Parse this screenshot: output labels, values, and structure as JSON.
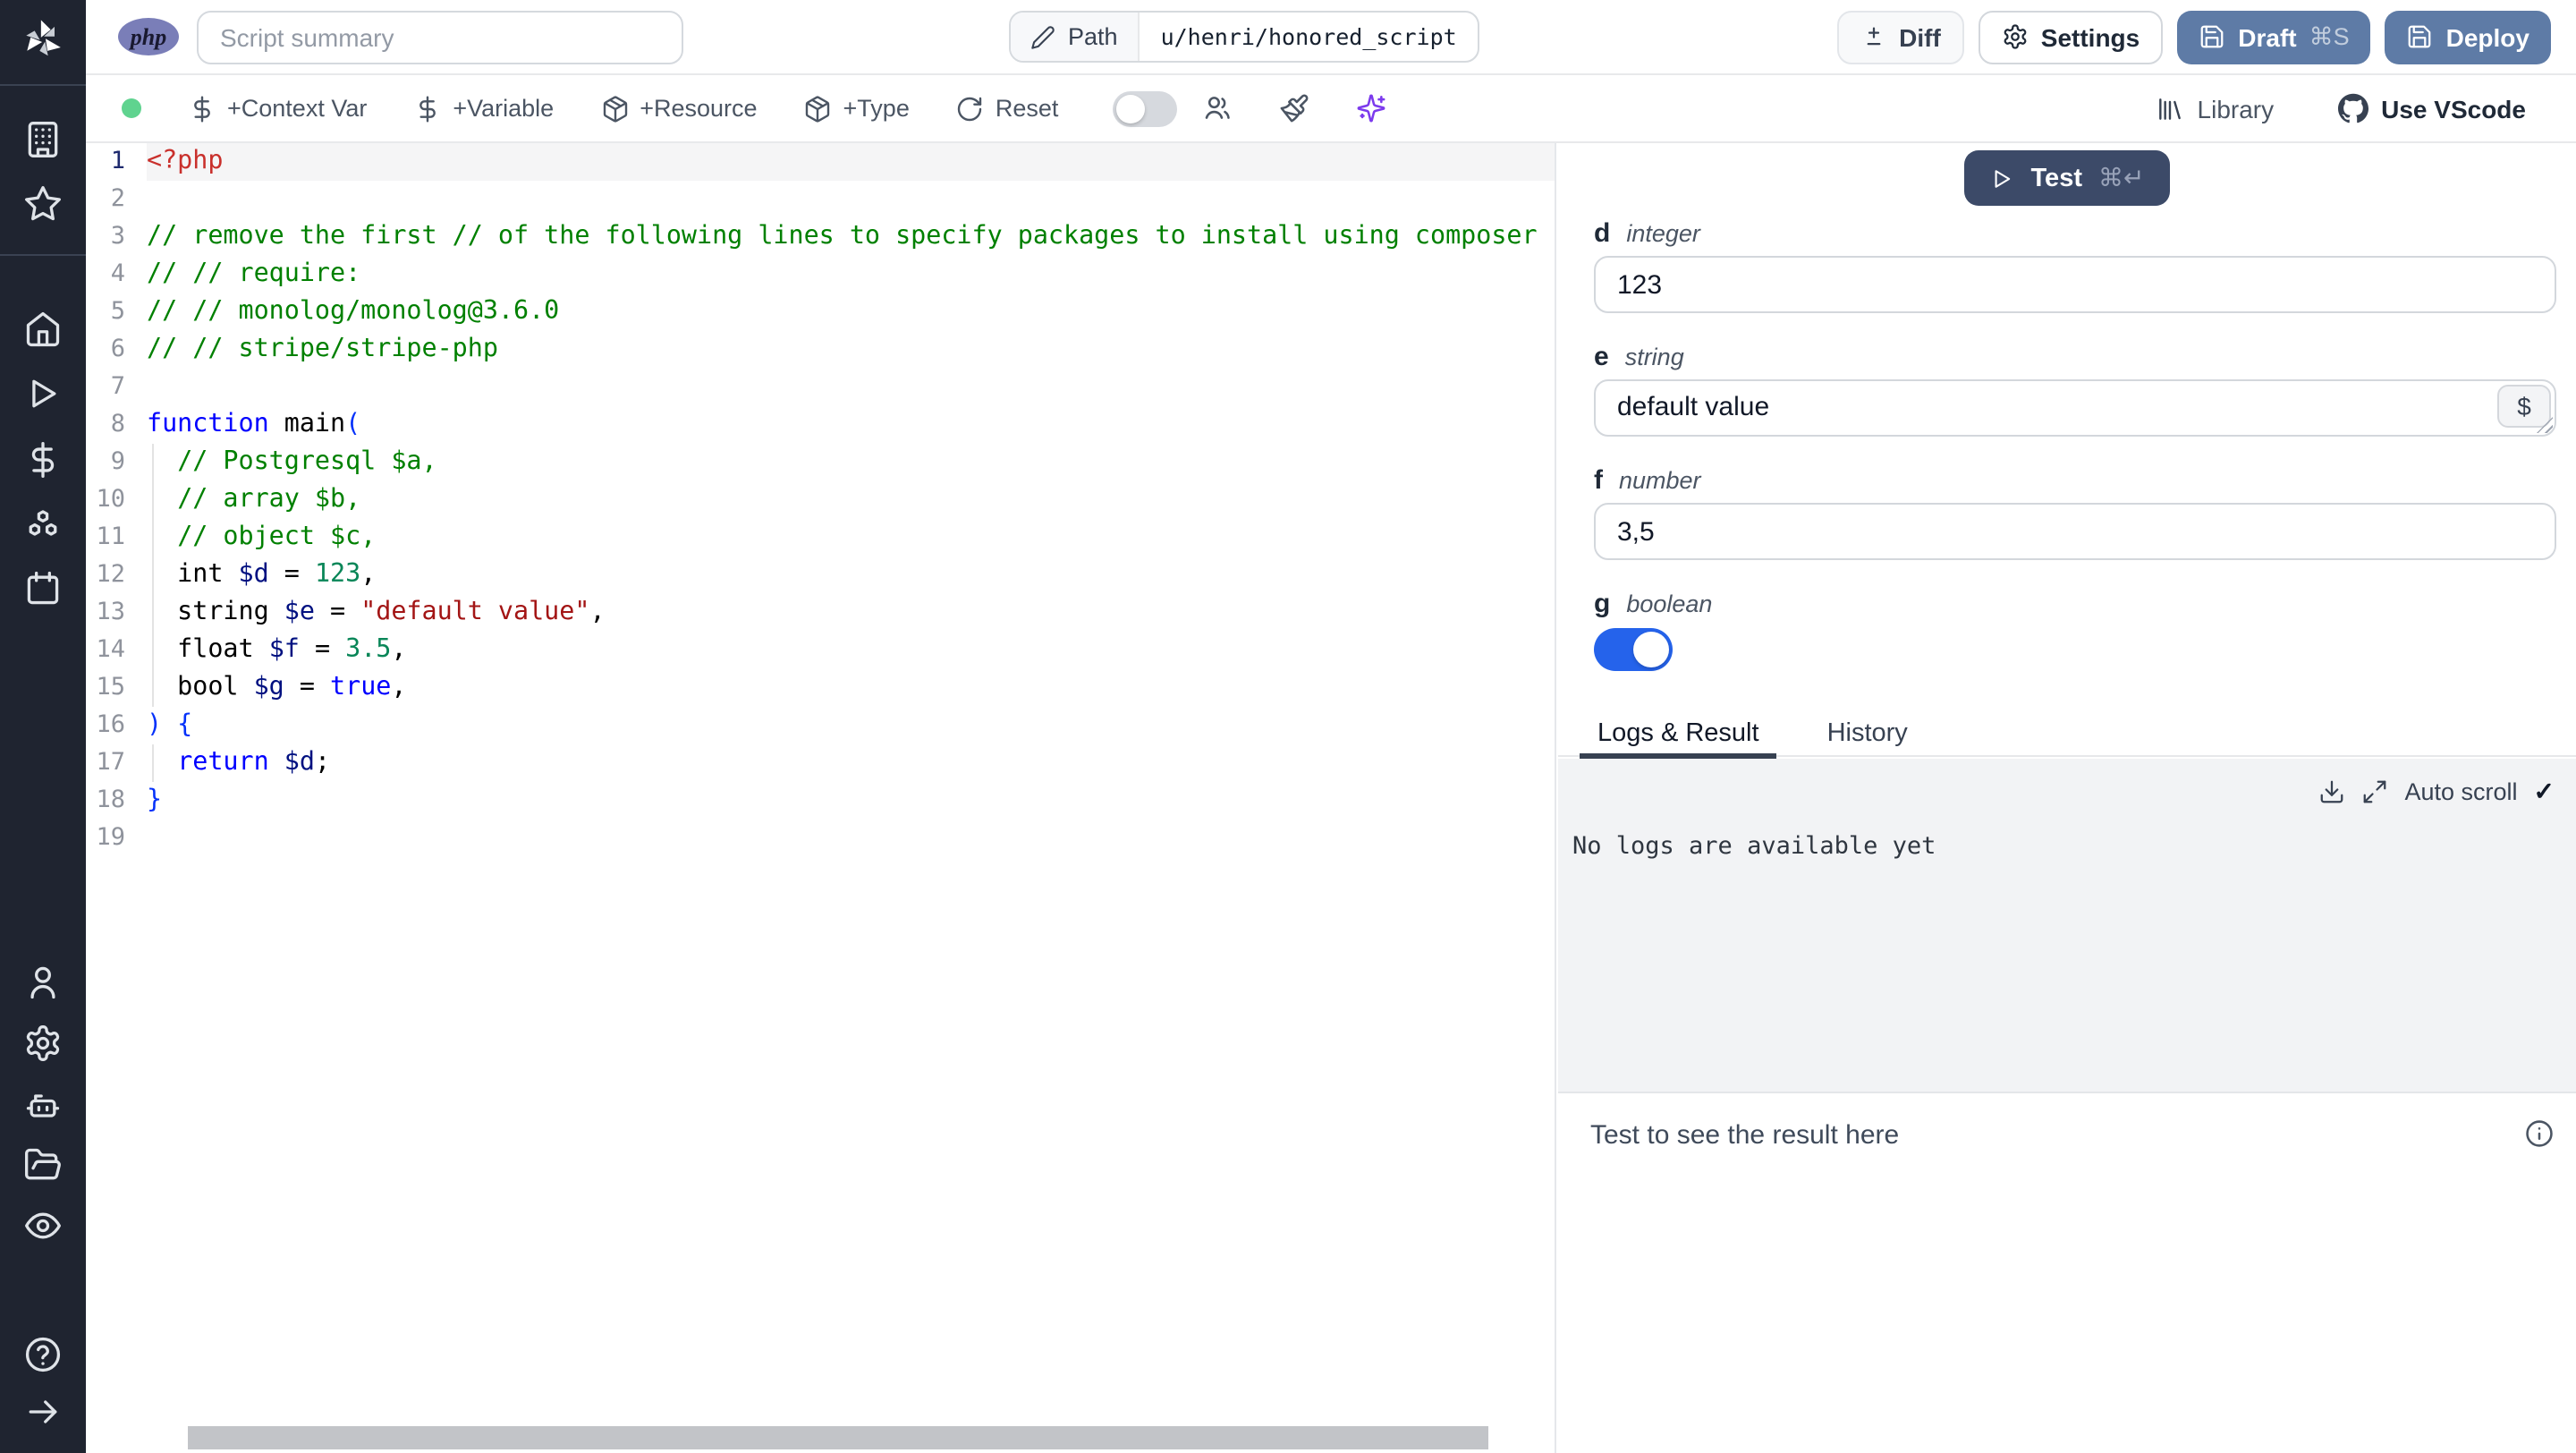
{
  "topbar": {
    "language_badge": "php",
    "summary_placeholder": "Script summary",
    "path_label": "Path",
    "path_value": "u/henri/honored_script",
    "diff_label": "Diff",
    "settings_label": "Settings",
    "draft_label": "Draft",
    "draft_shortcut": "⌘S",
    "deploy_label": "Deploy"
  },
  "toolbar": {
    "context_var_label": "+Context Var",
    "variable_label": "+Variable",
    "resource_label": "+Resource",
    "type_label": "+Type",
    "reset_label": "Reset",
    "assistant_toggle": false,
    "library_label": "Library",
    "vscode_label": "Use VScode"
  },
  "sidebar": {
    "icons": [
      {
        "name": "workspace-building-icon",
        "icon": "building"
      },
      {
        "name": "favorites-star-icon",
        "icon": "star"
      },
      {
        "name": "home-icon",
        "icon": "home"
      },
      {
        "name": "runs-play-icon",
        "icon": "play"
      },
      {
        "name": "variables-dollar-icon",
        "icon": "dollar"
      },
      {
        "name": "resources-boxes-icon",
        "icon": "boxes"
      },
      {
        "name": "schedules-calendar-icon",
        "icon": "calendar"
      },
      {
        "name": "user-icon",
        "icon": "user"
      },
      {
        "name": "settings-gear-icon",
        "icon": "gear"
      },
      {
        "name": "workers-bot-icon",
        "icon": "bot"
      },
      {
        "name": "folders-icon",
        "icon": "folder-open"
      },
      {
        "name": "audit-eye-icon",
        "icon": "eye"
      },
      {
        "name": "help-icon",
        "icon": "help"
      },
      {
        "name": "expand-sidebar-arrow-icon",
        "icon": "arrow-right"
      }
    ]
  },
  "editor": {
    "active_line": 1,
    "lines": [
      {
        "n": 1,
        "seg": [
          {
            "t": "<?php",
            "c": "meta"
          }
        ]
      },
      {
        "n": 2,
        "seg": []
      },
      {
        "n": 3,
        "seg": [
          {
            "t": "// remove the first // of the following lines to specify packages to install using composer",
            "c": "comment"
          }
        ]
      },
      {
        "n": 4,
        "seg": [
          {
            "t": "// // require:",
            "c": "comment"
          }
        ]
      },
      {
        "n": 5,
        "seg": [
          {
            "t": "// // monolog/monolog@3.6.0",
            "c": "comment"
          }
        ]
      },
      {
        "n": 6,
        "seg": [
          {
            "t": "// // stripe/stripe-php",
            "c": "comment"
          }
        ]
      },
      {
        "n": 7,
        "seg": []
      },
      {
        "n": 8,
        "seg": [
          {
            "t": "function",
            "c": "kw"
          },
          {
            "t": " main",
            "c": "plain"
          },
          {
            "t": "(",
            "c": "bracket"
          }
        ]
      },
      {
        "n": 9,
        "seg": [
          {
            "t": "  ",
            "c": "plain"
          },
          {
            "t": "// Postgresql $a,",
            "c": "comment"
          }
        ]
      },
      {
        "n": 10,
        "seg": [
          {
            "t": "  ",
            "c": "plain"
          },
          {
            "t": "// array $b,",
            "c": "comment"
          }
        ]
      },
      {
        "n": 11,
        "seg": [
          {
            "t": "  ",
            "c": "plain"
          },
          {
            "t": "// object $c,",
            "c": "comment"
          }
        ]
      },
      {
        "n": 12,
        "seg": [
          {
            "t": "  int ",
            "c": "plain"
          },
          {
            "t": "$d",
            "c": "var"
          },
          {
            "t": " = ",
            "c": "plain"
          },
          {
            "t": "123",
            "c": "num"
          },
          {
            "t": ",",
            "c": "plain"
          }
        ]
      },
      {
        "n": 13,
        "seg": [
          {
            "t": "  string ",
            "c": "plain"
          },
          {
            "t": "$e",
            "c": "var"
          },
          {
            "t": " = ",
            "c": "plain"
          },
          {
            "t": "\"default value\"",
            "c": "str"
          },
          {
            "t": ",",
            "c": "plain"
          }
        ]
      },
      {
        "n": 14,
        "seg": [
          {
            "t": "  float ",
            "c": "plain"
          },
          {
            "t": "$f",
            "c": "var"
          },
          {
            "t": " = ",
            "c": "plain"
          },
          {
            "t": "3.5",
            "c": "num"
          },
          {
            "t": ",",
            "c": "plain"
          }
        ]
      },
      {
        "n": 15,
        "seg": [
          {
            "t": "  bool ",
            "c": "plain"
          },
          {
            "t": "$g",
            "c": "var"
          },
          {
            "t": " = ",
            "c": "plain"
          },
          {
            "t": "true",
            "c": "kw"
          },
          {
            "t": ",",
            "c": "plain"
          }
        ]
      },
      {
        "n": 16,
        "seg": [
          {
            "t": ") {",
            "c": "bracket"
          }
        ]
      },
      {
        "n": 17,
        "seg": [
          {
            "t": "  ",
            "c": "plain"
          },
          {
            "t": "return",
            "c": "kw"
          },
          {
            "t": " ",
            "c": "plain"
          },
          {
            "t": "$d",
            "c": "var"
          },
          {
            "t": ";",
            "c": "plain"
          }
        ]
      },
      {
        "n": 18,
        "seg": [
          {
            "t": "}",
            "c": "bracket"
          }
        ]
      },
      {
        "n": 19,
        "seg": []
      }
    ]
  },
  "runpanel": {
    "test_label": "Test",
    "test_shortcut": "⌘↵",
    "variable_picker_label": "$",
    "fields": [
      {
        "name": "d",
        "type": "integer",
        "value": "123"
      },
      {
        "name": "e",
        "type": "string",
        "value": "default value"
      },
      {
        "name": "f",
        "type": "number",
        "value": "3,5"
      },
      {
        "name": "g",
        "type": "boolean",
        "value": true
      }
    ],
    "tabs": [
      "Logs & Result",
      "History"
    ],
    "autoscroll_label": "Auto scroll",
    "autoscroll_check": "✓",
    "no_logs_text": "No logs are available yet",
    "result_placeholder": "Test to see the result here"
  },
  "colors": {
    "sidebar_bg": "#1f2430",
    "primary_button": "#5e7ba6",
    "test_button": "#3c4a68",
    "toggle_on": "#2563eb",
    "status_dot": "#5fd38f",
    "ai_sparkles": "#7c3aed",
    "php_badge": "#7a7eb8",
    "logs_bg": "#f2f3f5"
  }
}
